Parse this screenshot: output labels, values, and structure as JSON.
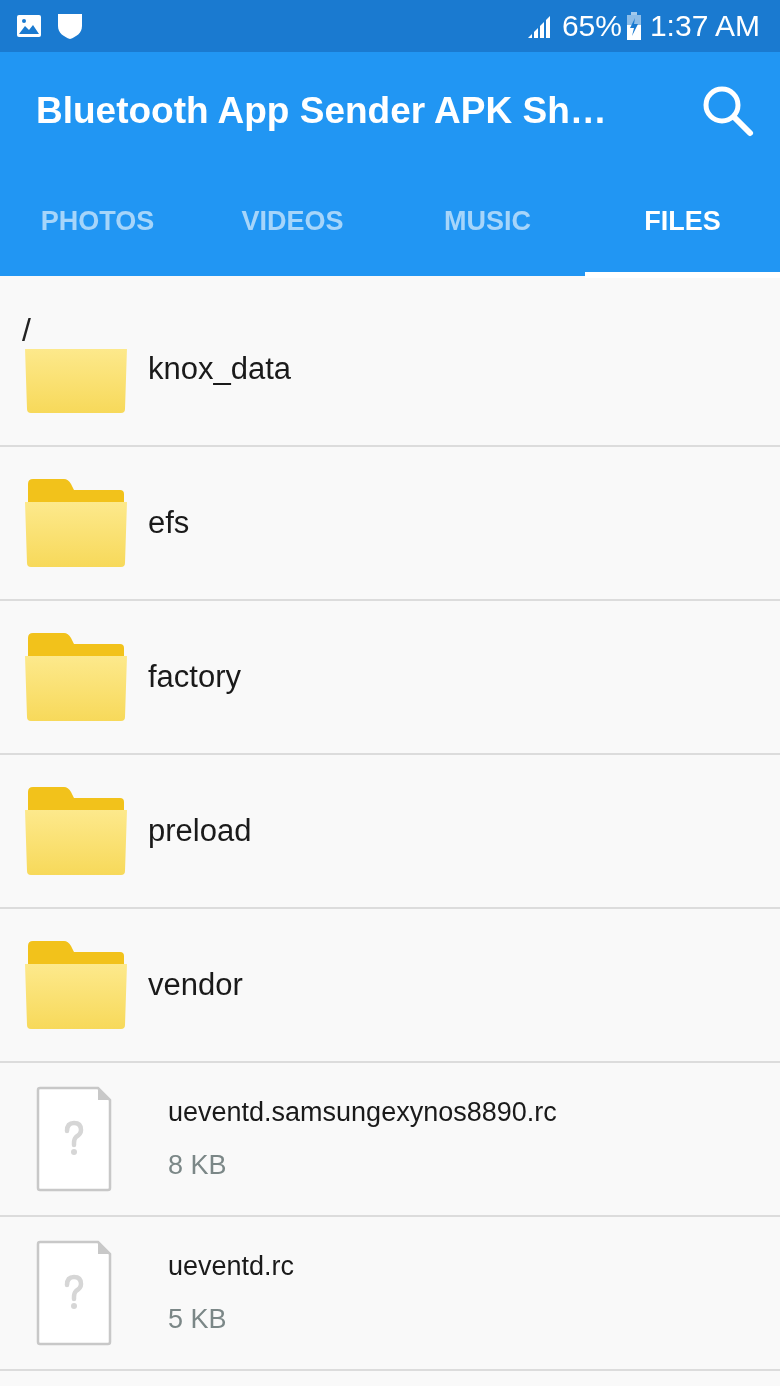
{
  "status_bar": {
    "battery": "65%",
    "time": "1:37 AM"
  },
  "app_bar": {
    "title": "Bluetooth App Sender APK Sh…"
  },
  "tabs": [
    {
      "label": "PHOTOS",
      "selected": false
    },
    {
      "label": "VIDEOS",
      "selected": false
    },
    {
      "label": "MUSIC",
      "selected": false
    },
    {
      "label": "FILES",
      "selected": true
    }
  ],
  "path": "/",
  "items": [
    {
      "kind": "folder",
      "name": "knox_data"
    },
    {
      "kind": "folder",
      "name": "efs"
    },
    {
      "kind": "folder",
      "name": "factory"
    },
    {
      "kind": "folder",
      "name": "preload"
    },
    {
      "kind": "folder",
      "name": "vendor"
    },
    {
      "kind": "file",
      "name": "ueventd.samsungexynos8890.rc",
      "size": "8 KB"
    },
    {
      "kind": "file",
      "name": "ueventd.rc",
      "size": "5 KB"
    }
  ]
}
